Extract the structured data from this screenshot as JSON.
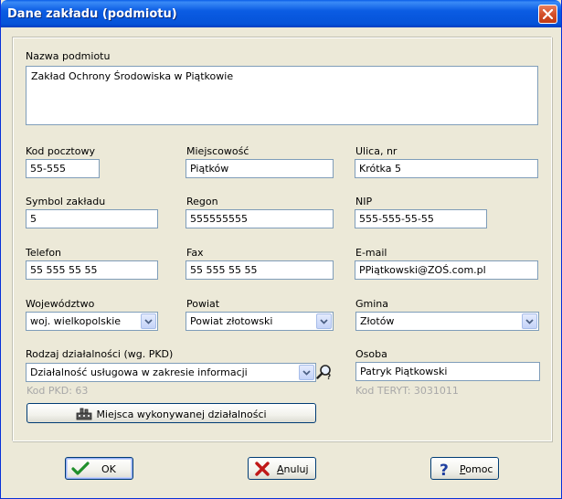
{
  "window": {
    "title": "Dane zakładu (podmiotu)"
  },
  "form": {
    "nazwa_label": "Nazwa podmiotu",
    "nazwa_value": "Zakład Ochrony Środowiska w Piątkowie",
    "kod_pocztowy_label": "Kod pocztowy",
    "kod_pocztowy_value": "55-555",
    "miejscowosc_label": "Miejscowość",
    "miejscowosc_value": "Piątków",
    "ulica_label": "Ulica, nr",
    "ulica_value": "Krótka 5",
    "symbol_label": "Symbol zakładu",
    "symbol_value": "5",
    "regon_label": "Regon",
    "regon_value": "555555555",
    "nip_label": "NIP",
    "nip_value": "555-555-55-55",
    "telefon_label": "Telefon",
    "telefon_value": "55 555 55 55",
    "fax_label": "Fax",
    "fax_value": "55 555 55 55",
    "email_label": "E-mail",
    "email_value": "PPiątkowski@ZOŚ.com.pl",
    "wojewodztwo_label": "Województwo",
    "wojewodztwo_value": "woj.  wielkopolskie",
    "powiat_label": "Powiat",
    "powiat_value": "Powiat złotowski",
    "gmina_label": "Gmina",
    "gmina_value": "Złotów",
    "rodzaj_label": "Rodzaj działalności (wg. PKD)",
    "rodzaj_value": "Działalność usługowa w zakresie informacji",
    "kod_pkd_text": "Kod PKD: 63",
    "osoba_label": "Osoba",
    "osoba_value": "Patryk Piątkowski",
    "kod_teryt_text": "Kod TERYT: 3031011",
    "miejsca_button_label": "Miejsca wykonywanej działalności"
  },
  "buttons": {
    "ok_label": "OK",
    "anuluj_label": "Anuluj",
    "pomoc_label": "Pomoc"
  },
  "icons": {
    "close": "close-x-icon",
    "lookup": "magnifier-lookup-icon",
    "miejsca": "building-icon",
    "ok": "checkmark-icon",
    "anuluj": "red-x-icon",
    "pomoc": "question-mark-icon"
  },
  "colors": {
    "title_bar": "#0553d8",
    "dialog_face": "#ece9d8",
    "field_border": "#7f9db9",
    "button_border": "#003c74",
    "ok_check": "#1f8f2a",
    "cancel_x": "#c01818",
    "help_q": "#1f3f9f",
    "hint_text": "#a8a8a8"
  }
}
